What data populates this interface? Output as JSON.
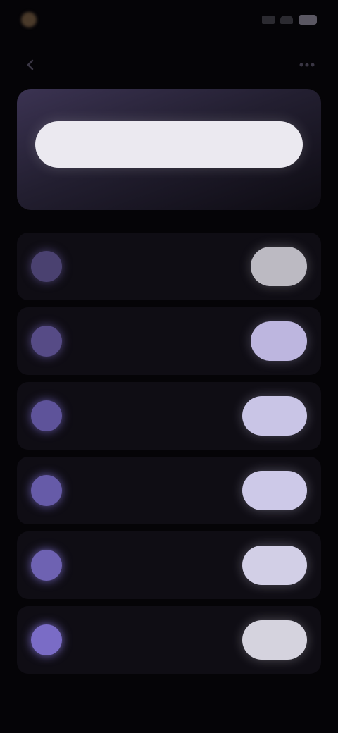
{
  "status_bar": {
    "time": "",
    "icons": [
      "signal-icon",
      "wifi-icon",
      "battery-icon"
    ]
  },
  "nav": {
    "back_icon": "chevron-left-icon",
    "title": "",
    "menu_icon": "more-icon"
  },
  "hero": {
    "button_label": "",
    "subtitle": ""
  },
  "list": {
    "items": [
      {
        "title": "",
        "subtitle": "",
        "action_label": "",
        "icon": "circle-icon"
      },
      {
        "title": "",
        "subtitle": "",
        "action_label": "",
        "icon": "circle-icon"
      },
      {
        "title": "",
        "subtitle": "",
        "action_label": "",
        "icon": "circle-icon"
      },
      {
        "title": "",
        "subtitle": "",
        "action_label": "",
        "icon": "circle-icon"
      },
      {
        "title": "",
        "subtitle": "",
        "action_label": "",
        "icon": "circle-icon"
      },
      {
        "title": "",
        "subtitle": "",
        "action_label": "",
        "icon": "circle-icon"
      }
    ]
  },
  "colors": {
    "background": "#050407",
    "accent": "#8f82d8",
    "card": "#0f0d14",
    "hero_top": "#3b3352",
    "button_light": "#ebe9f0"
  }
}
